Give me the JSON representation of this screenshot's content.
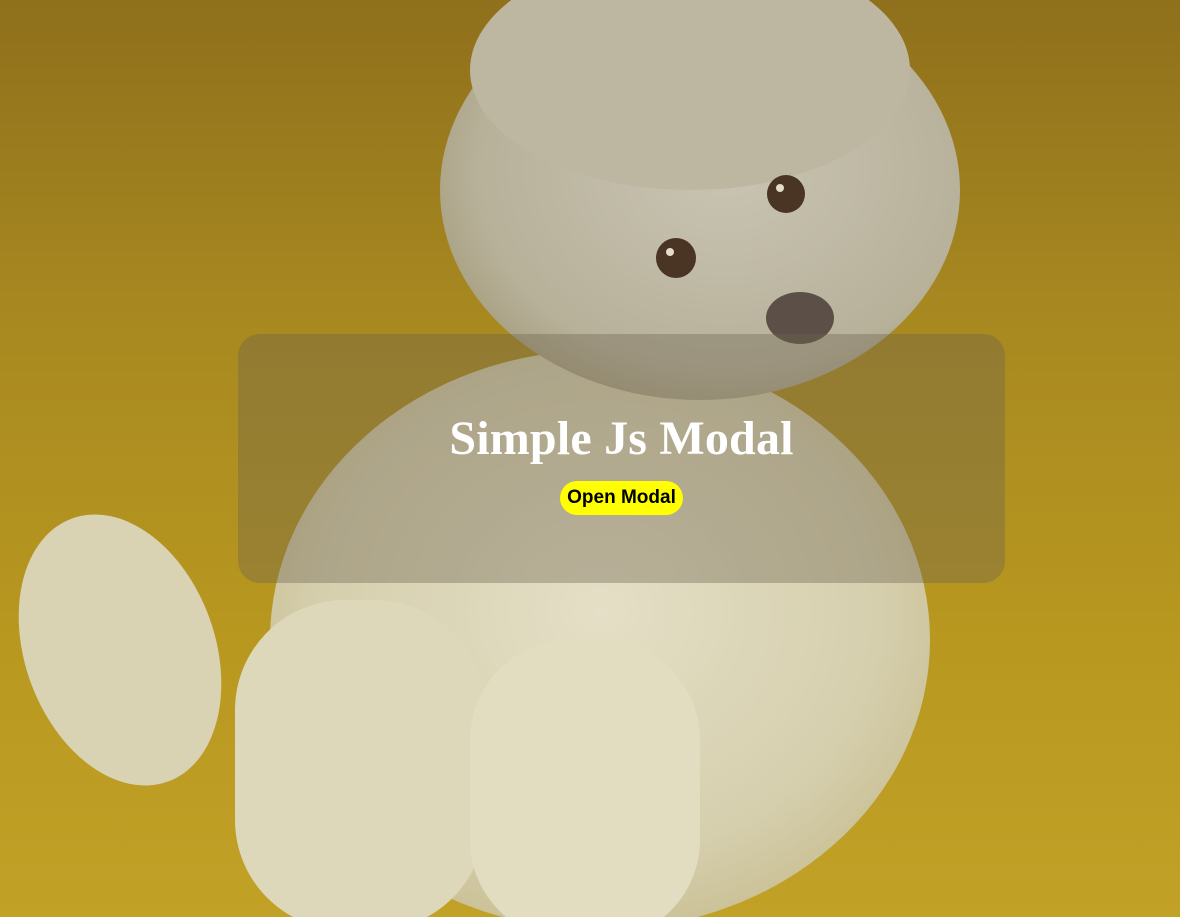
{
  "page": {
    "title": "Simple Js Modal"
  },
  "actions": {
    "open_modal_label": "Open Modal"
  },
  "background": {
    "subject": "white-poodle-photo",
    "colors": {
      "yellow": "#b8981f",
      "fur": "#d9d3b8"
    }
  },
  "button_color": "#ffff00"
}
